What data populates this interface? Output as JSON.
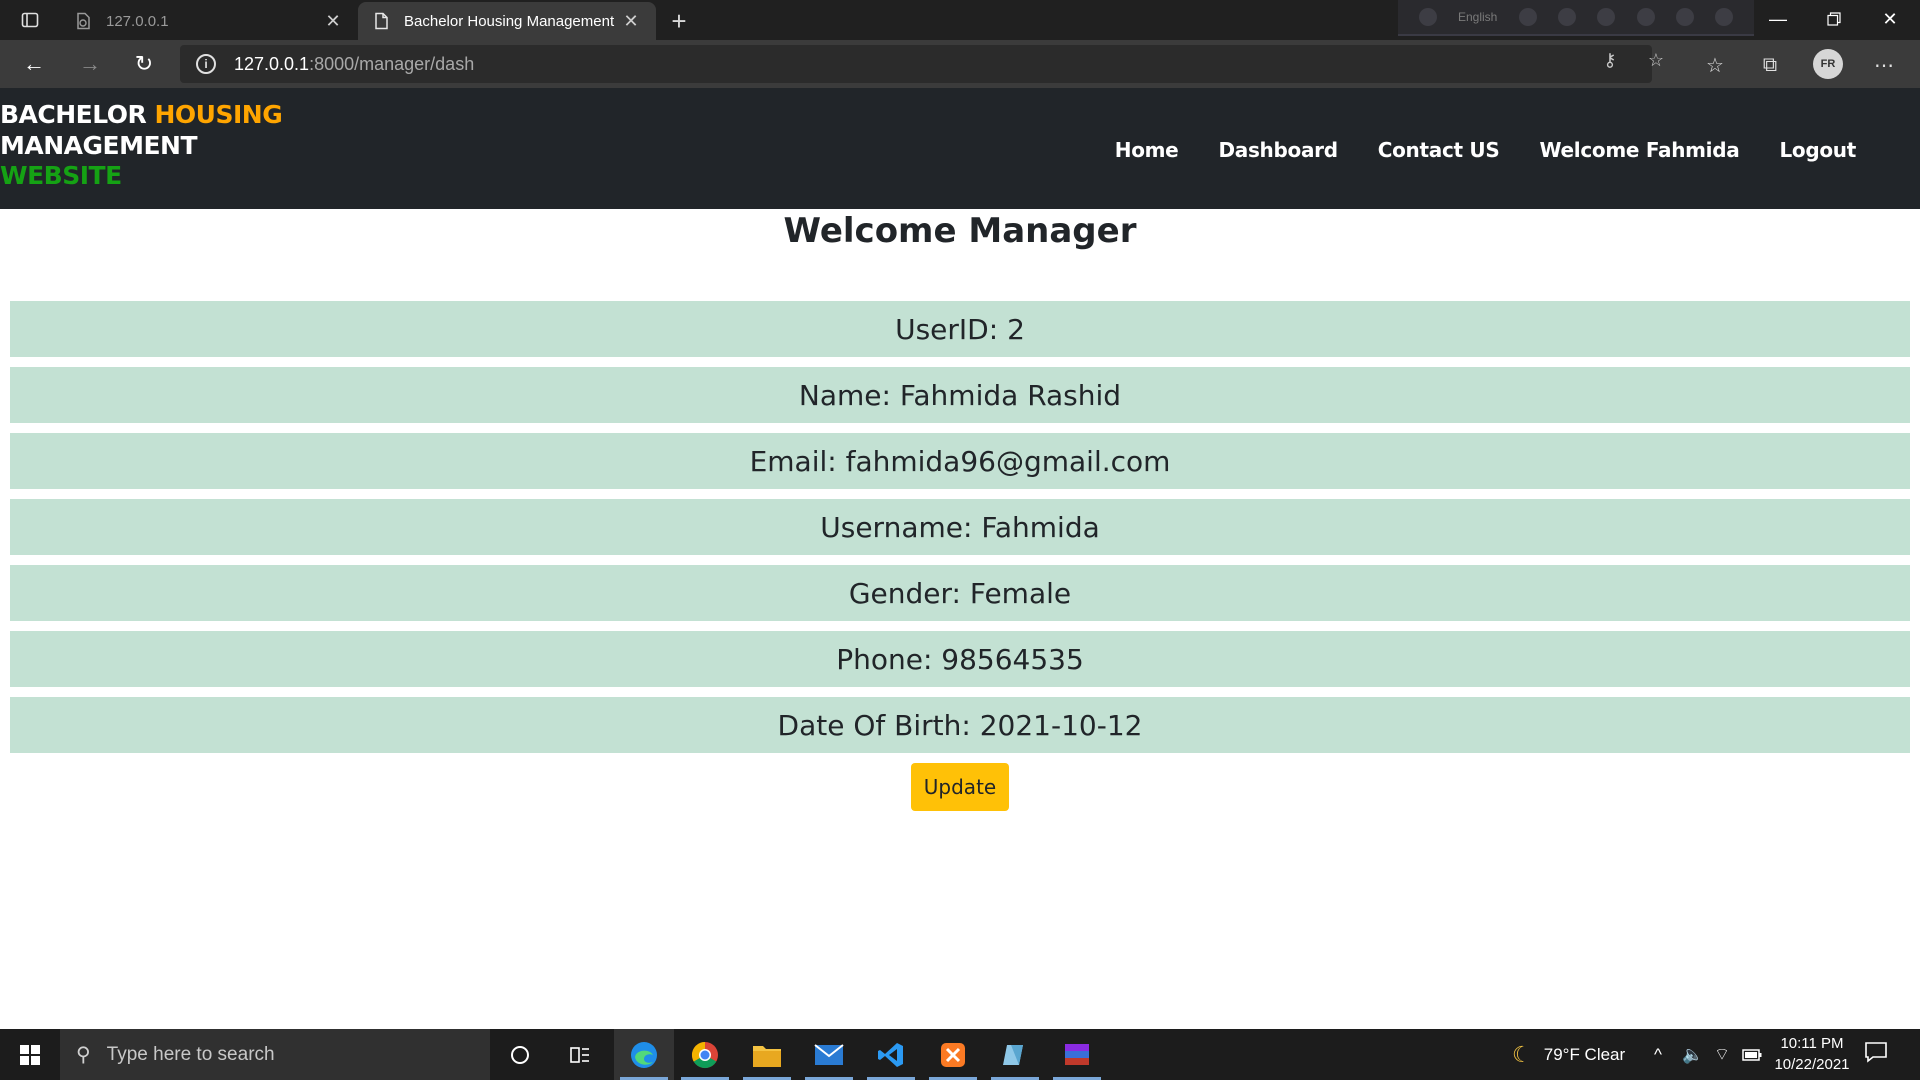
{
  "browser": {
    "tabs": [
      {
        "title": "127.0.0.1",
        "active": false
      },
      {
        "title": "Bachelor Housing Management",
        "active": true
      }
    ],
    "url_host": "127.0.0.1",
    "url_rest": ":8000/manager/dash",
    "extension_language": "English",
    "profile_initials": "FR"
  },
  "site": {
    "brand": {
      "part1": "BACHELOR ",
      "part2": "HOUSING",
      "part3": "MANAGEMENT",
      "part4": "WEBSITE"
    },
    "nav": [
      {
        "label": "Home"
      },
      {
        "label": "Dashboard"
      },
      {
        "label": "Contact US"
      },
      {
        "label": "Welcome Fahmida"
      },
      {
        "label": "Logout"
      }
    ],
    "colors": {
      "header_bg": "#212529",
      "orange": "#ffa500",
      "green": "#15a214",
      "row_bg": "#c3e1d3",
      "button_bg": "#ffc107"
    }
  },
  "main": {
    "title": "Welcome Manager",
    "rows": [
      "UserID: 2",
      "Name: Fahmida Rashid",
      "Email: fahmida96@gmail.com",
      "Username: Fahmida",
      "Gender: Female",
      "Phone: 98564535",
      "Date Of Birth: 2021-10-12"
    ],
    "update_label": "Update"
  },
  "taskbar": {
    "search_placeholder": "Type here to search",
    "weather": "79°F  Clear",
    "time": "10:11 PM",
    "date": "10/22/2021"
  }
}
